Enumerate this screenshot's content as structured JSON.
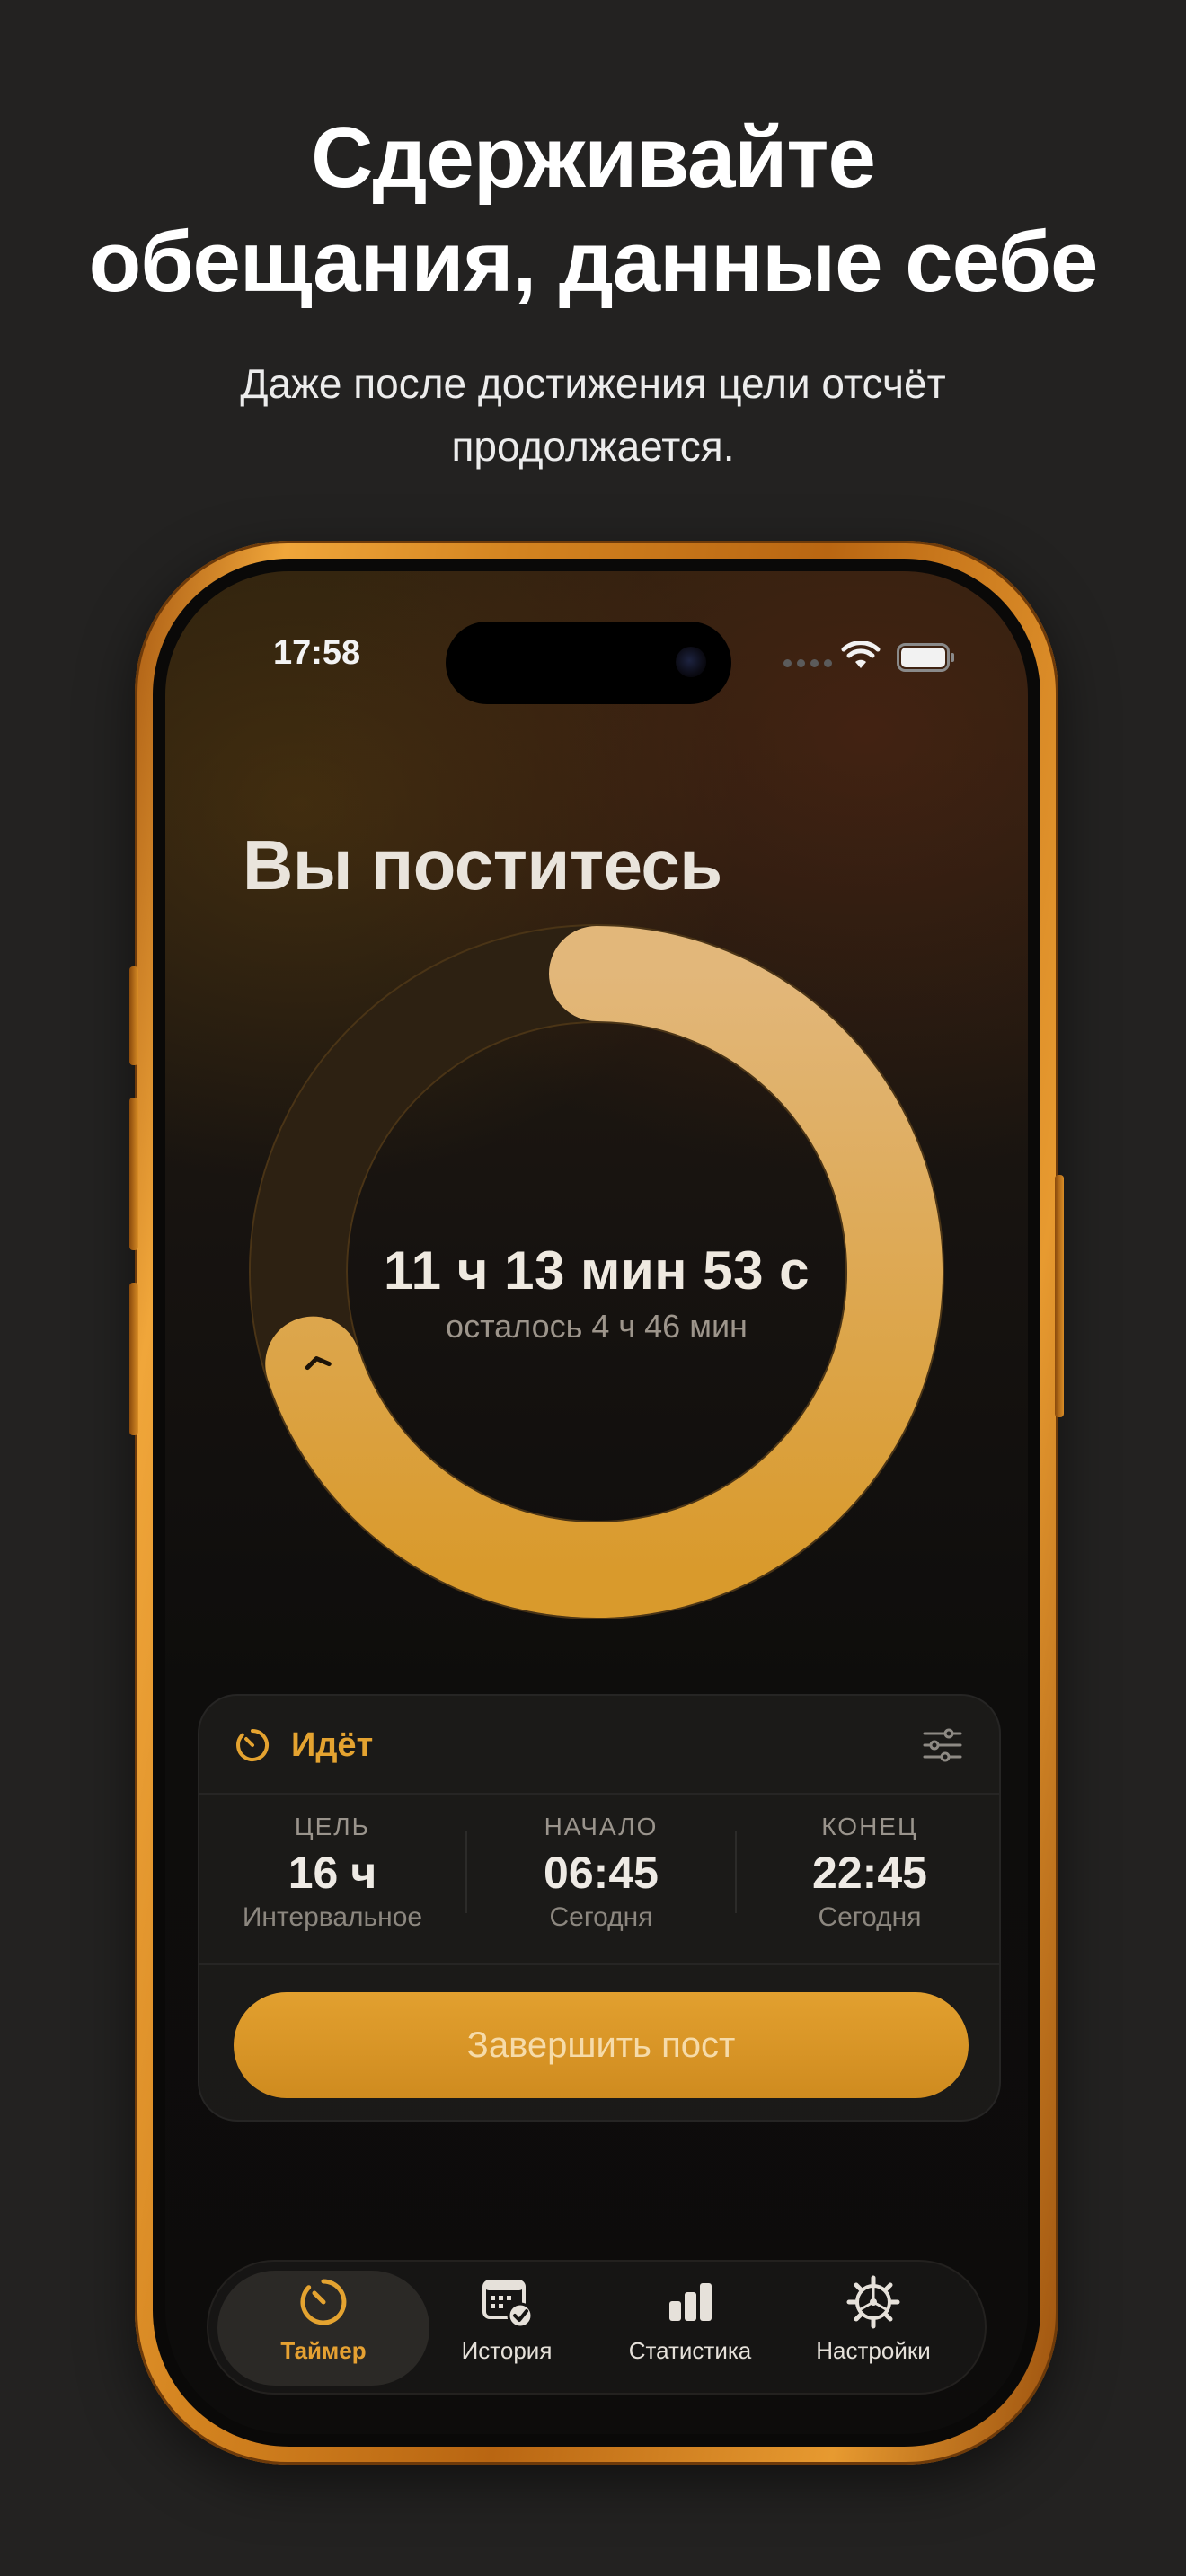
{
  "promo": {
    "headline_line1": "Сдерживайте",
    "headline_line2": "обещания, данные себе",
    "subtitle_line1": "Даже после достижения цели отсчёт",
    "subtitle_line2": "продолжается."
  },
  "status_bar": {
    "time": "17:58",
    "icons": [
      "signal-dots-icon",
      "wifi-icon",
      "battery-icon"
    ]
  },
  "screen": {
    "title": "Вы поститесь",
    "timer": {
      "elapsed": "11 ч 13 мин 53 с",
      "remaining": "осталось 4 ч 46 мин",
      "progress_fraction": 0.7
    }
  },
  "card": {
    "status": "Идёт",
    "status_icon": "timer-icon",
    "settings_icon": "sliders-icon",
    "stats": [
      {
        "label": "ЦЕЛЬ",
        "value": "16 ч",
        "sub": "Интервальное"
      },
      {
        "label": "НАЧАЛО",
        "value": "06:45",
        "sub": "Сегодня"
      },
      {
        "label": "КОНЕЦ",
        "value": "22:45",
        "sub": "Сегодня"
      }
    ],
    "finish_button": "Завершить пост"
  },
  "tabbar": {
    "items": [
      {
        "label": "Таймер",
        "icon": "timer-icon",
        "active": true
      },
      {
        "label": "История",
        "icon": "calendar-check-icon",
        "active": false
      },
      {
        "label": "Статистика",
        "icon": "bar-chart-icon",
        "active": false
      },
      {
        "label": "Настройки",
        "icon": "gear-icon",
        "active": false
      }
    ]
  },
  "colors": {
    "accent": "#E4A330",
    "ring_light": "#E2B77A",
    "ring_dark": "#D99A2C",
    "background": "#232221",
    "frame": "#D48420"
  }
}
